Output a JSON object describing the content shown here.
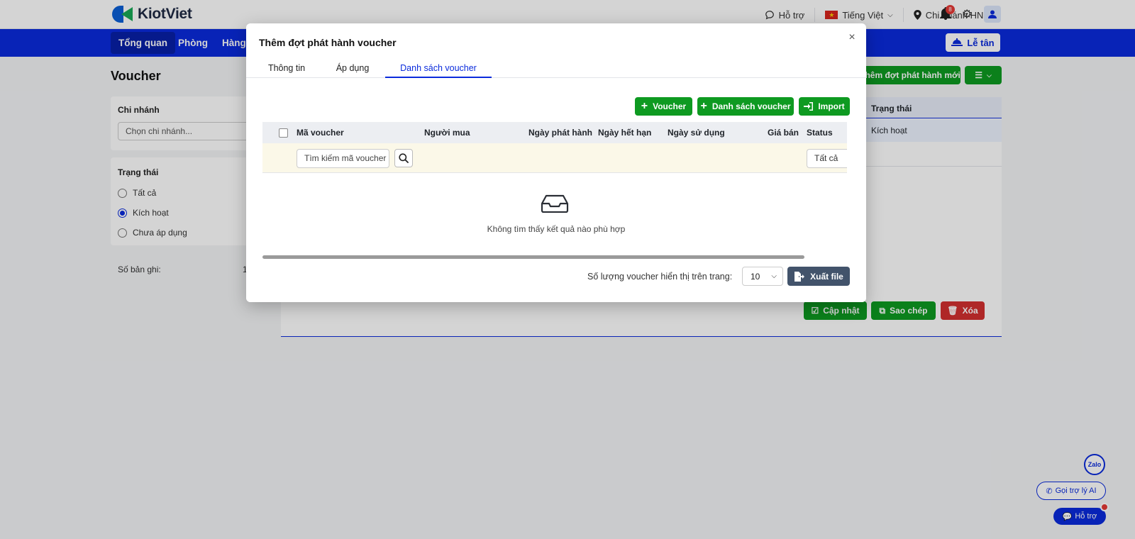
{
  "brand": {
    "name": "KiotViet"
  },
  "topbar": {
    "support": "Hỗ trợ",
    "language": "Tiếng Việt",
    "branch": "Chi nhánh HN",
    "notification_count": "8"
  },
  "nav": {
    "items": [
      "Tổng quan",
      "Phòng",
      "Hàng"
    ],
    "reception": "Lễ tân"
  },
  "page": {
    "title": "Voucher",
    "branch_filter": {
      "title": "Chi nhánh",
      "placeholder": "Chọn chi nhánh..."
    },
    "status_filter": {
      "title": "Trạng thái",
      "options": [
        "Tất cả",
        "Kích hoạt",
        "Chưa áp dụng"
      ],
      "selected": "Kích hoạt"
    },
    "records_label": "Số bản ghi:",
    "records_value": "1",
    "add_button": "Thêm đợt phát hành mới",
    "table_status_header": "Trạng thái",
    "table_status_value": "Kích hoạt",
    "update_button": "Cập nhật",
    "copy_button": "Sao chép",
    "delete_button": "Xóa"
  },
  "modal": {
    "title": "Thêm đợt phát hành voucher",
    "tabs": [
      "Thông tin",
      "Áp dụng",
      "Danh sách voucher"
    ],
    "active_tab": "Danh sách voucher",
    "buttons": {
      "voucher": "Voucher",
      "voucher_list": "Danh sách voucher",
      "import": "Import"
    },
    "columns": [
      "Mã voucher",
      "Người mua",
      "Ngày phát hành",
      "Ngày hết hạn",
      "Ngày sử dụng",
      "Giá bán",
      "Status"
    ],
    "search_placeholder": "Tìm kiếm mã voucher",
    "status_filter_value": "Tất cả",
    "empty_text": "Không tìm thấy kết quả nào phù hợp",
    "page_size_label": "Số lượng voucher hiển thị trên trang:",
    "page_size": "10",
    "export_button": "Xuất file"
  },
  "floating": {
    "zalo": "Zalo",
    "ai_assistant": "Gọi trợ lý AI",
    "support": "Hỗ trợ"
  },
  "colors": {
    "primary": "#0a2bdc",
    "success": "#0e9a21",
    "danger": "#d32f2f",
    "export": "#42536b"
  }
}
